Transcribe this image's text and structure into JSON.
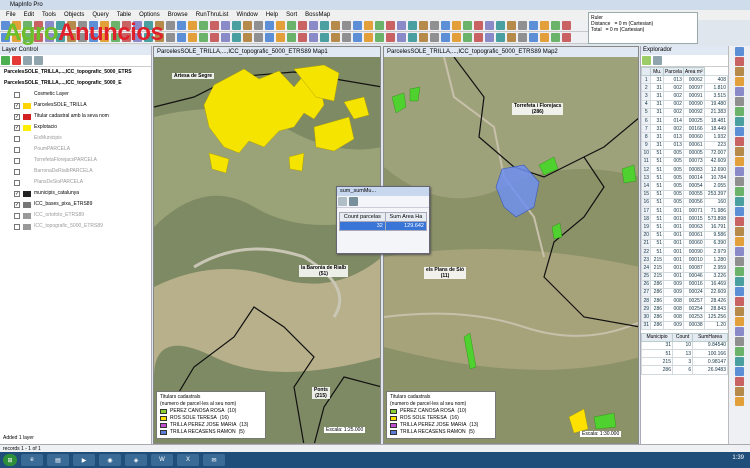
{
  "app": {
    "title": "MapInfo Pro",
    "menu": [
      "File",
      "Edit",
      "Tools",
      "Objects",
      "Query",
      "Table",
      "Options",
      "Browse",
      "RunThruList",
      "Window",
      "Help",
      "Sort",
      "BossMap"
    ]
  },
  "watermark": {
    "part1": "Agro",
    "part2": "Anuncios"
  },
  "ruler": {
    "title": "Ruler",
    "distance_label": "Distance",
    "distance_value": "= 0 m (Cartesian)",
    "total_label": "Total",
    "total_value": "= 0 m (Cartesian)"
  },
  "layer_control": {
    "title": "Layer Control",
    "map_entries": [
      "ParcelesSOLE_TRILLA,...,ICC_topografic_5000_ETRS",
      "ParcelesSOLE_TRILLA,...,ICC_topografic_5000_E"
    ],
    "layers": [
      {
        "name": "Cosmetic Layer",
        "checked": false,
        "dim": false,
        "swatch": ""
      },
      {
        "name": "ParcelesSOLE_TRILLA",
        "checked": true,
        "dim": false,
        "swatch": "#ffd400"
      },
      {
        "name": "Titular cadastral amb la seva nom",
        "checked": true,
        "dim": false,
        "swatch": "#d02020"
      },
      {
        "name": "Explotacio",
        "checked": true,
        "dim": false,
        "swatch": "#ffee00"
      },
      {
        "name": "EixMunicipis",
        "checked": false,
        "dim": true,
        "swatch": ""
      },
      {
        "name": "PoumPARCELA",
        "checked": false,
        "dim": true,
        "swatch": ""
      },
      {
        "name": "TorrefetaFlorejacsPARCELA",
        "checked": false,
        "dim": true,
        "swatch": ""
      },
      {
        "name": "BarronaDeRialbPARCELA",
        "checked": false,
        "dim": true,
        "swatch": ""
      },
      {
        "name": "PlansDeSioPARCELA",
        "checked": false,
        "dim": true,
        "swatch": ""
      },
      {
        "name": "municipis_catalunya",
        "checked": true,
        "dim": false,
        "swatch": "#222"
      },
      {
        "name": "ICC_bases_pixa_ETRS89",
        "checked": true,
        "dim": false,
        "swatch": "#777"
      },
      {
        "name": "ICC_ortofoto_ETRS89",
        "checked": false,
        "dim": true,
        "swatch": "#999"
      },
      {
        "name": "ICC_topografic_5000_ETRS89",
        "checked": false,
        "dim": true,
        "swatch": "#999"
      }
    ],
    "footer": "Added 1 layer"
  },
  "map1": {
    "title": "ParcelesSOLE_TRILLA,...,ICC_topografic_5000_ETRS89 Map1",
    "places": [
      {
        "name": "Artesa de Segre"
      },
      {
        "name": "la Baronia de Rialb",
        "sub": "(51)"
      },
      {
        "name": "Ponts",
        "sub": "(215)"
      }
    ],
    "legend_title": "Titulars cadastrals",
    "legend_sub": "(numero de parcel·les al seu nom)",
    "legend": [
      {
        "label": "PEREZ CANOSA ROSA",
        "count": "(10)",
        "color": "#8ad12f"
      },
      {
        "label": "ROS SOLE TERESA",
        "count": "(16)",
        "color": "#ffe100"
      },
      {
        "label": "TRILLA PEREZ JOSE MARIA",
        "count": "(13)",
        "color": "#c050d0"
      },
      {
        "label": "TRILLA RECASENS RAMON",
        "count": "(5)",
        "color": "#5b7cd6"
      }
    ],
    "scale": "Escala: 1:25.000"
  },
  "map2": {
    "title": "ParcelesSOLE_TRILLA,...,ICC_topografic_5000_ETRS89 Map2",
    "places": [
      {
        "name": "Torrefeta i Florejacs",
        "sub": "(286)"
      },
      {
        "name": "els Plans de Sió",
        "sub": "(11)"
      }
    ],
    "legend_title": "Titulars cadastrals",
    "legend_sub": "(numero de parcel·les al seu nom)",
    "legend": [
      {
        "label": "PEREZ CANOSA ROSA",
        "count": "(10)",
        "color": "#8ad12f"
      },
      {
        "label": "ROS SOLE TERESA",
        "count": "(16)",
        "color": "#ffe100"
      },
      {
        "label": "TRILLA PEREZ JOSE MARIA",
        "count": "(13)",
        "color": "#c050d0"
      },
      {
        "label": "TRILLA RECASENS RAMON",
        "count": "(5)",
        "color": "#5b7cd6"
      }
    ],
    "scale": "Escala: 1:30.000"
  },
  "sum_window": {
    "title": "sum_sumMu...",
    "col1": "Count parcelas",
    "col2": "Sum Area Ha",
    "val1": "32",
    "val2": "129.642"
  },
  "explorer": {
    "title": "Explorador",
    "headers": [
      "N°",
      "Mu.",
      "Parcela",
      "Area m²"
    ],
    "rows": [
      [
        "1",
        "31",
        "013",
        "00062",
        "408"
      ],
      [
        "2",
        "31",
        "002",
        "00097",
        "1.810"
      ],
      [
        "3",
        "31",
        "002",
        "00091",
        "3.515"
      ],
      [
        "4",
        "31",
        "002",
        "00090",
        "19.480"
      ],
      [
        "5",
        "31",
        "002",
        "00092",
        "21.383"
      ],
      [
        "6",
        "31",
        "014",
        "00025",
        "18.481"
      ],
      [
        "7",
        "31",
        "002",
        "00166",
        "18.449"
      ],
      [
        "8",
        "31",
        "013",
        "00060",
        "1.932"
      ],
      [
        "9",
        "31",
        "013",
        "00061",
        "223"
      ],
      [
        "10",
        "51",
        "005",
        "00005",
        "72.007"
      ],
      [
        "11",
        "51",
        "005",
        "00073",
        "42.609"
      ],
      [
        "12",
        "51",
        "005",
        "00083",
        "12.690"
      ],
      [
        "13",
        "51",
        "005",
        "00014",
        "10.784"
      ],
      [
        "14",
        "51",
        "005",
        "00054",
        "2.055"
      ],
      [
        "15",
        "51",
        "005",
        "00055",
        "253.397"
      ],
      [
        "16",
        "51",
        "005",
        "00056",
        "160"
      ],
      [
        "17",
        "51",
        "001",
        "00071",
        "71.986"
      ],
      [
        "18",
        "51",
        "001",
        "00015",
        "573.898"
      ],
      [
        "19",
        "51",
        "001",
        "00063",
        "16.791"
      ],
      [
        "20",
        "51",
        "001",
        "00061",
        "9.586"
      ],
      [
        "21",
        "51",
        "001",
        "00060",
        "6.390"
      ],
      [
        "22",
        "51",
        "001",
        "00090",
        "2.979"
      ],
      [
        "23",
        "215",
        "001",
        "00010",
        "1.280"
      ],
      [
        "24",
        "215",
        "001",
        "00087",
        "2.959"
      ],
      [
        "25",
        "215",
        "001",
        "00046",
        "3.226"
      ],
      [
        "26",
        "286",
        "009",
        "00016",
        "16.469"
      ],
      [
        "27",
        "286",
        "009",
        "00024",
        "22.609"
      ],
      [
        "28",
        "286",
        "008",
        "00257",
        "28.426"
      ],
      [
        "29",
        "286",
        "008",
        "00254",
        "28.843"
      ],
      [
        "30",
        "286",
        "008",
        "00253",
        "125.256"
      ],
      [
        "31",
        "286",
        "009",
        "00038",
        "1.20"
      ]
    ],
    "summary_headers": [
      "Municipio",
      "Count",
      "SumHarea"
    ],
    "summary_rows": [
      [
        "31",
        "10",
        "9.84540"
      ],
      [
        "51",
        "13",
        "100.166"
      ],
      [
        "215",
        "3",
        "0.98147"
      ],
      [
        "286",
        "6",
        "26.9483"
      ]
    ]
  },
  "status": "records 1 - 1 of 1",
  "clock": "1:39"
}
